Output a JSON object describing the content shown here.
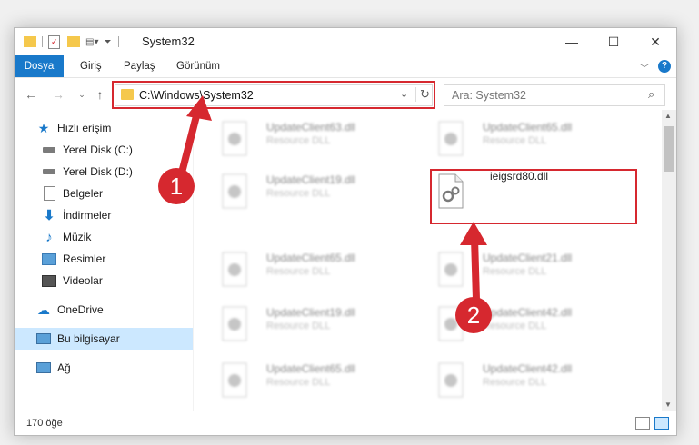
{
  "window": {
    "title": "System32",
    "controls": {
      "minimize": "—",
      "maximize": "☐",
      "close": "✕"
    }
  },
  "ribbon": {
    "tabs": [
      {
        "label": "Dosya"
      },
      {
        "label": "Giriş"
      },
      {
        "label": "Paylaş"
      },
      {
        "label": "Görünüm"
      }
    ]
  },
  "address": {
    "path": "C:\\Windows\\System32",
    "search_placeholder": "Ara: System32"
  },
  "sidebar": {
    "items": [
      {
        "label": "Hızlı erişim",
        "icon": "star-icon"
      },
      {
        "label": "Yerel Disk (C:)",
        "icon": "drive-icon"
      },
      {
        "label": "Yerel Disk (D:)",
        "icon": "drive-icon"
      },
      {
        "label": "Belgeler",
        "icon": "documents-icon"
      },
      {
        "label": "İndirmeler",
        "icon": "download-icon"
      },
      {
        "label": "Müzik",
        "icon": "music-icon"
      },
      {
        "label": "Resimler",
        "icon": "pictures-icon"
      },
      {
        "label": "Videolar",
        "icon": "video-icon"
      },
      {
        "label": "OneDrive",
        "icon": "cloud-icon"
      },
      {
        "label": "Bu bilgisayar",
        "icon": "computer-icon"
      },
      {
        "label": "Ağ",
        "icon": "network-icon"
      }
    ]
  },
  "files": [
    {
      "name": "UpdateClient63.dll",
      "desc": "Resource DLL"
    },
    {
      "name": "UpdateClient65.dll",
      "desc": "Resource DLL"
    },
    {
      "name": "UpdateClient19.dll",
      "desc": "Resource DLL"
    },
    {
      "name": "ieigsrd80.dll",
      "desc": ""
    },
    {
      "name": "UpdateClient65.dll",
      "desc": "Resource DLL"
    },
    {
      "name": "UpdateClient21.dll",
      "desc": "Resource DLL"
    },
    {
      "name": "UpdateClient19.dll",
      "desc": "Resource DLL"
    },
    {
      "name": "UpdateClient42.dll",
      "desc": "Resource DLL"
    },
    {
      "name": "UpdateClient65.dll",
      "desc": "Resource DLL"
    },
    {
      "name": "UpdateClient42.dll",
      "desc": "Resource DLL"
    }
  ],
  "status": {
    "item_count": "170 öğe"
  },
  "annotations": {
    "step1": "1",
    "step2": "2"
  },
  "colors": {
    "accent": "#1979ca",
    "highlight": "#d6282f"
  }
}
